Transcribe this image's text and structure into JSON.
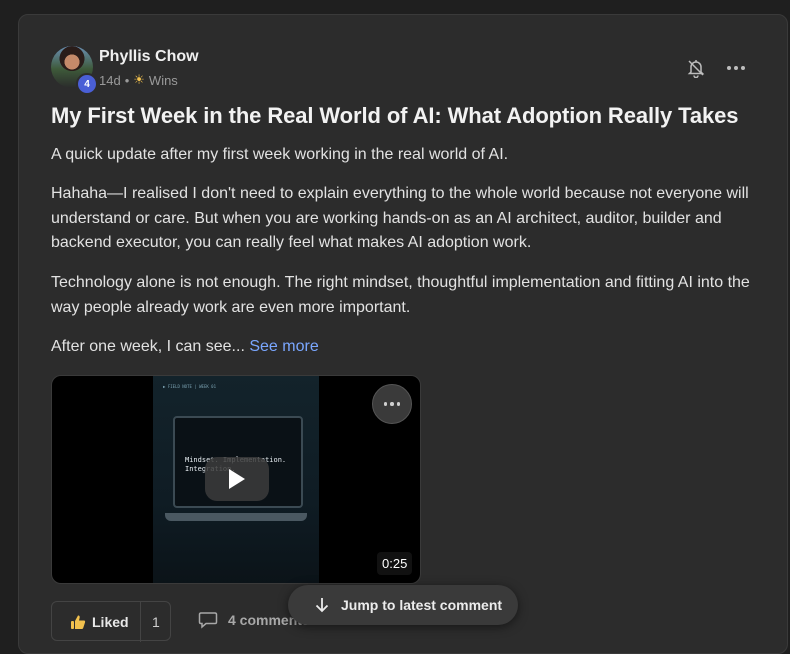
{
  "post": {
    "author": "Phyllis Chow",
    "level": "4",
    "age": "14d",
    "separator": "•",
    "category": "Wins",
    "title": "My First Week in the Real World of AI: What Adoption Really Takes",
    "paragraphs": [
      "A quick update after my first week working in the real world of AI.",
      "Hahaha—I realised I don't need to explain everything to the whole world because not everyone will understand or care. But when you are working hands-on as an AI architect, auditor, builder and backend executor, you can really feel what makes AI adoption work.",
      "Technology alone is not enough. The right mindset, thoughtful implementation and fitting AI into the way people already work are even more important.",
      "After one week, I can see..."
    ],
    "see_more": "See more"
  },
  "video": {
    "duration": "0:25",
    "caption": "▶ FIELD NOTE | WEEK 01",
    "screen_text": "Mindset. Implementation.\nIntegration."
  },
  "actions": {
    "liked_label": "Liked",
    "like_count": "1",
    "comments_label": "4 comments",
    "jump_label": "Jump to latest comment"
  },
  "colors": {
    "accent": "#7aa7ff",
    "badge": "#4a5fd6",
    "background": "#2c2c2c"
  }
}
